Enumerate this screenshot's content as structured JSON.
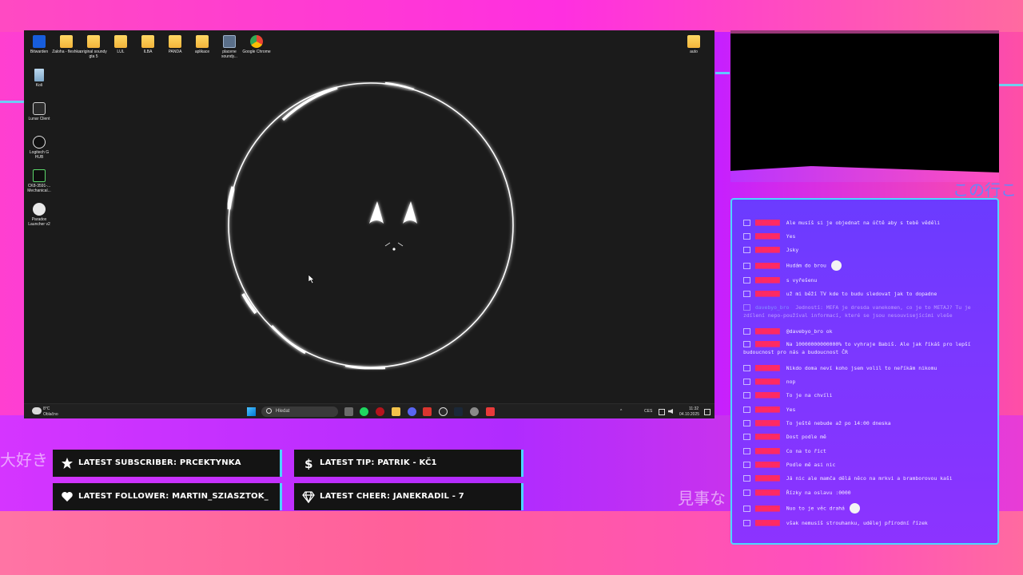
{
  "overlay": {
    "stats": [
      {
        "label": "LATEST SUBSCRIBER: PRCEKTYNKA",
        "icon": "star-icon"
      },
      {
        "label": "LATEST TIP: PATRIK - KČ1",
        "icon": "dollar-icon"
      },
      {
        "label": "LATEST FOLLOWER: MARTIN_SZIASZTOK_",
        "icon": "heart-icon"
      },
      {
        "label": "LATEST CHEER: JANEKRADIL - 7",
        "icon": "diamond-icon"
      }
    ],
    "colors": {
      "accent": "#4cd7ff",
      "pink": "#ff3fd0",
      "purple": "#7a38ff",
      "chat_user": "#ff2a62"
    }
  },
  "desktop": {
    "icons": [
      {
        "label": "Bitwarden",
        "icon": "bitwarden-icon"
      },
      {
        "label": "Zaloha - fleshka",
        "icon": "folder-icon"
      },
      {
        "label": "original soundy gta 5",
        "icon": "folder-icon"
      },
      {
        "label": "LUL",
        "icon": "folder-icon"
      },
      {
        "label": "ILBA",
        "icon": "folder-icon"
      },
      {
        "label": "PANDA",
        "icon": "folder-icon"
      },
      {
        "label": "aplikace",
        "icon": "folder-icon"
      },
      {
        "label": "placene soundy...",
        "icon": "video-file-icon"
      },
      {
        "label": "Google Chrome",
        "icon": "chrome-icon"
      },
      {
        "label": "auto",
        "icon": "folder-icon"
      },
      {
        "label": "Koš",
        "icon": "recycle-bin-icon"
      },
      {
        "label": "Lunar Client",
        "icon": "lunar-client-icon"
      },
      {
        "label": "Logitech G HUB",
        "icon": "logitech-icon"
      },
      {
        "label": "CK8-3591-... Mechanical...",
        "icon": "keyboard-app-icon"
      },
      {
        "label": "Paradox Launcher v2",
        "icon": "paradox-icon"
      }
    ]
  },
  "taskbar": {
    "weather_temp": "8°C",
    "weather_desc": "Oblačno",
    "search_placeholder": "Hledat",
    "lang": "CES",
    "time": "11:32",
    "date": "04.10.2025"
  },
  "chat": {
    "messages": [
      {
        "user": "████████",
        "text": "Ale musíš si je objednat na účtě aby s tebě věděli",
        "emoji": false
      },
      {
        "user": "████████",
        "text": "Yes",
        "emoji": false
      },
      {
        "user": "████████",
        "text": "Jsky",
        "emoji": false
      },
      {
        "user": "████████",
        "text": "Hudám do brou",
        "emoji": true
      },
      {
        "user": "████████",
        "text": "s vyřešenu",
        "emoji": false
      },
      {
        "user": "████████",
        "text": "už mi běží TV kde to budu sledovat jak to dopadne",
        "emoji": false
      },
      {
        "user": "davebyo_bro",
        "text": "Jedností: MEFA je dresda vanekomen, co je to METAJ? Tu je zdílení nepo-používal informací, které se jsou nesouvisejícími vleše",
        "emoji": false,
        "highlight": true
      },
      {
        "user": "████████",
        "text": "@davebyo_bro ok",
        "emoji": false
      },
      {
        "user": "████████",
        "text": "Na 10000000000000% to vyhraje Babiš. Ale jak říkáš pro lepší budoucnost pro nás a budoucnost ČR",
        "emoji": false
      },
      {
        "user": "████████",
        "text": "Nikdo doma neví koho jsem volil to neříkám nikomu",
        "emoji": false
      },
      {
        "user": "████████",
        "text": "nop",
        "emoji": false
      },
      {
        "user": "████████",
        "text": "To je na chvíli",
        "emoji": false
      },
      {
        "user": "████████",
        "text": "Yes",
        "emoji": false
      },
      {
        "user": "████████",
        "text": "To ještě nebude až po 14:00 dneska",
        "emoji": false
      },
      {
        "user": "████████",
        "text": "Dost podle mě",
        "emoji": false
      },
      {
        "user": "████████",
        "text": "Co na to říct",
        "emoji": false
      },
      {
        "user": "████████",
        "text": "Podle mě asi nic",
        "emoji": false
      },
      {
        "user": "████████",
        "text": "Já nic ale mamča dělá něco na mrkvi a bramborovou kaši",
        "emoji": false
      },
      {
        "user": "████████",
        "text": "Řízky na oslavu :0000",
        "emoji": false
      },
      {
        "user": "████████",
        "text": "Nuo to je věc drahá",
        "emoji": true
      },
      {
        "user": "████████",
        "text": "však nemusíš strouhanku, udělej přírodní řízek",
        "emoji": false
      }
    ]
  },
  "bg_text": {
    "left": "大好き",
    "right": "見事な",
    "top_right": "この行こ"
  }
}
